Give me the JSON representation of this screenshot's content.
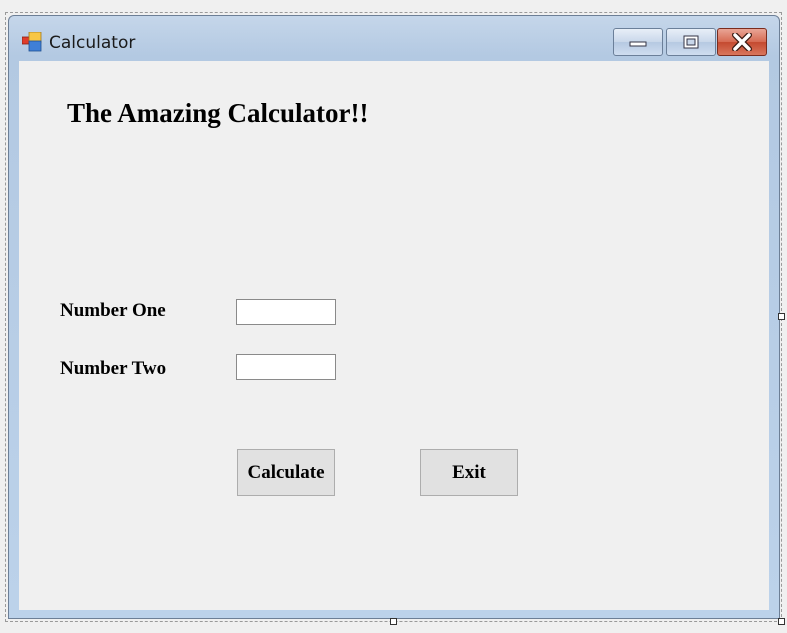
{
  "window": {
    "title": "Calculator",
    "controls": {
      "minimize": "minimize-icon",
      "maximize": "maximize-icon",
      "close": "close-icon"
    }
  },
  "form": {
    "heading": "The Amazing Calculator!!",
    "number_one": {
      "label": "Number One",
      "value": ""
    },
    "number_two": {
      "label": "Number Two",
      "value": ""
    },
    "buttons": {
      "calculate": "Calculate",
      "exit": "Exit"
    }
  },
  "colors": {
    "title_bar": "#b9cde5",
    "close_button": "#c9503a",
    "client_background": "#f0f0f0",
    "button_face": "#e1e1e1"
  }
}
